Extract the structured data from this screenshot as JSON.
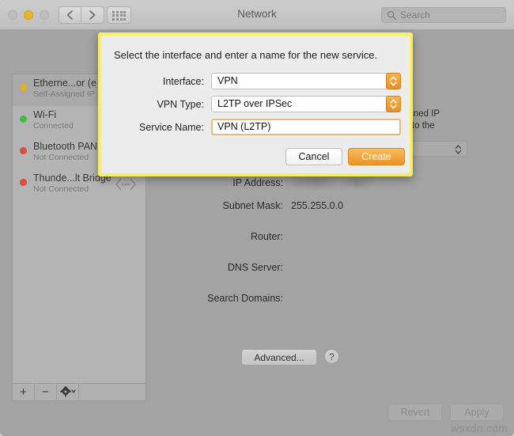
{
  "window": {
    "title": "Network",
    "traffic_lights": [
      "close",
      "minimize",
      "zoom"
    ]
  },
  "toolbar": {
    "back_icon": "chevron-left-icon",
    "forward_icon": "chevron-right-icon",
    "grid_icon": "grid-icon",
    "search": {
      "icon": "search-icon",
      "placeholder": "Search",
      "value": ""
    }
  },
  "sidebar": {
    "services": [
      {
        "name": "Etherne...or (e",
        "status": "Self-Assigned IP",
        "dot": "#e3b11f",
        "selected": true,
        "icon": ""
      },
      {
        "name": "Wi-Fi",
        "status": "Connected",
        "dot": "#3fbf3f",
        "selected": false,
        "icon": ""
      },
      {
        "name": "Bluetooth PAN",
        "status": "Not Connected",
        "dot": "#e04a3b",
        "selected": false,
        "icon": ""
      },
      {
        "name": "Thunde...lt Bridge",
        "status": "Not Connected",
        "dot": "#e04a3b",
        "selected": false,
        "icon": "thunderbolt-icon"
      }
    ],
    "toolbar": {
      "add_label": "+",
      "remove_label": "−",
      "gear_label": "gear-icon"
    }
  },
  "detail": {
    "warning_text": "assigned IP\nnect to the",
    "configure_value": "",
    "fields": [
      {
        "label": "IP Address:",
        "value": "",
        "redacted": true
      },
      {
        "label": "Subnet Mask:",
        "value": "255.255.0.0",
        "redacted": false
      },
      {
        "label": "Router:",
        "value": "",
        "redacted": false
      },
      {
        "label": "DNS Server:",
        "value": "",
        "redacted": false
      },
      {
        "label": "Search Domains:",
        "value": "",
        "redacted": false
      }
    ],
    "advanced_label": "Advanced...",
    "help_label": "?",
    "revert_label": "Revert",
    "apply_label": "Apply"
  },
  "sheet": {
    "prompt": "Select the interface and enter a name for the new service.",
    "rows": [
      {
        "label": "Interface:",
        "value": "VPN",
        "type": "popup"
      },
      {
        "label": "VPN Type:",
        "value": "L2TP over IPSec",
        "type": "popup"
      },
      {
        "label": "Service Name:",
        "value": "VPN (L2TP)",
        "type": "textfield"
      }
    ],
    "cancel_label": "Cancel",
    "create_label": "Create",
    "highlight_color": "#f7ef5e",
    "accent_color": "#ed9227"
  },
  "watermark": "wsxdn.com"
}
